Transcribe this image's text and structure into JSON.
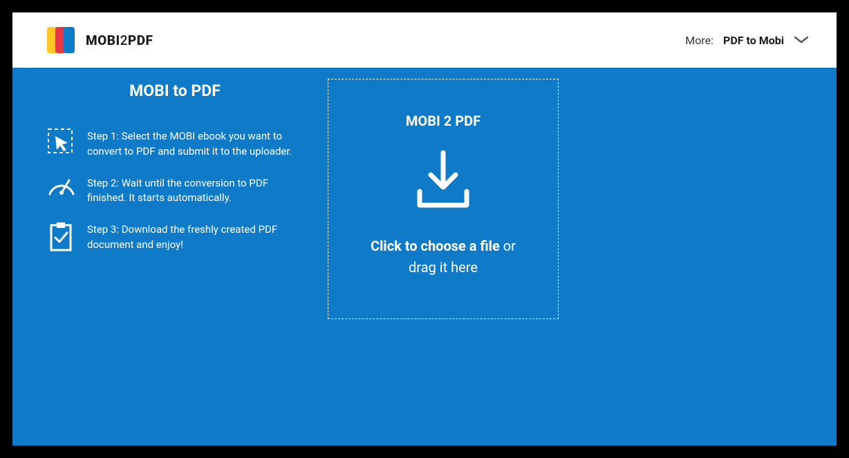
{
  "header": {
    "logo_text_1": "MOBI",
    "logo_text_2": "2",
    "logo_text_3": "PDF",
    "more_label": "More:",
    "more_link": "PDF to Mobi"
  },
  "left": {
    "title": "MOBI to PDF",
    "step1": "Step 1: Select the MOBI ebook you want to convert to PDF and submit it to the uploader.",
    "step2": "Step 2: Wait until the conversion to PDF finished. It starts automatically.",
    "step3": "Step 3: Download the freshly created PDF document and enjoy!"
  },
  "dropzone": {
    "title": "MOBI 2 PDF",
    "cta_bold": "Click to choose a file",
    "cta_rest_1": " or",
    "cta_rest_2": "drag it here"
  }
}
